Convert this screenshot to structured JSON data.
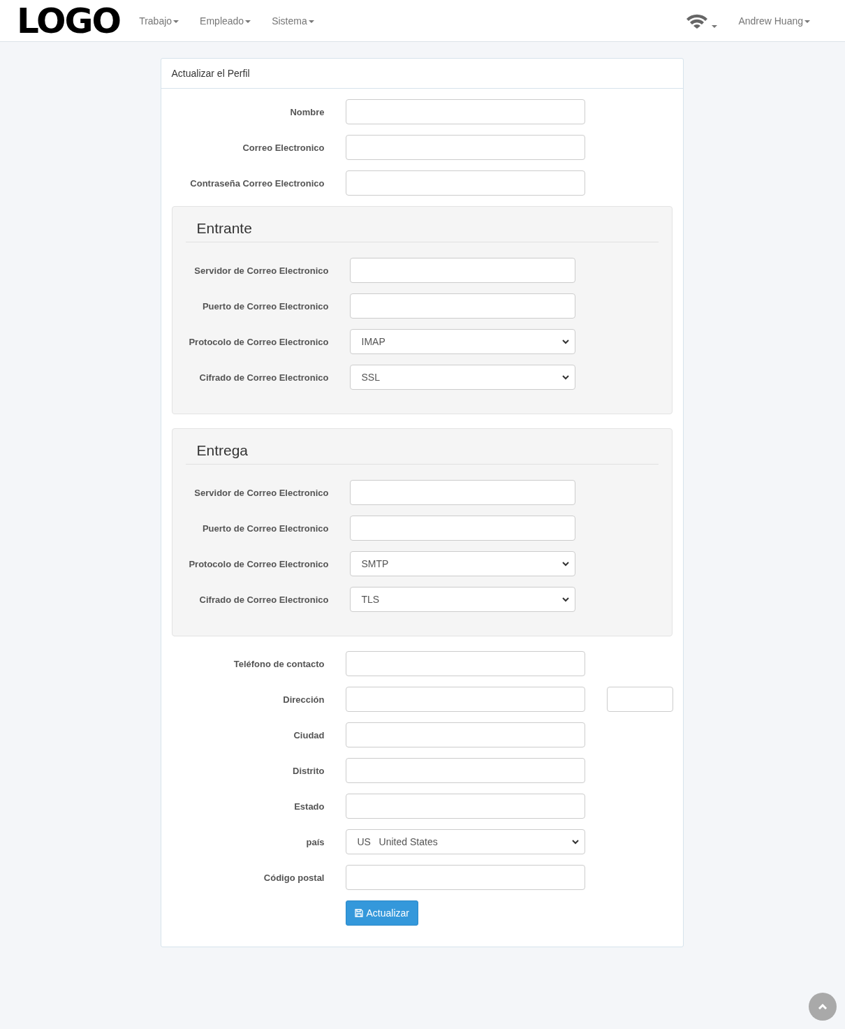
{
  "navbar": {
    "logo": "LOGO",
    "menus": [
      {
        "label": "Trabajo"
      },
      {
        "label": "Empleado"
      },
      {
        "label": "Sistema"
      }
    ],
    "user": "Andrew Huang"
  },
  "panel": {
    "title": "Actualizar el Perfil",
    "fields": [
      {
        "label": "Nombre",
        "kind": "text"
      },
      {
        "label": "Correo Electronico",
        "kind": "text"
      },
      {
        "label": "Contraseña Correo Electronico",
        "kind": "text"
      }
    ],
    "sections": [
      {
        "title": "Entrante",
        "fields": [
          {
            "label": "Servidor de Correo Electronico",
            "kind": "text"
          },
          {
            "label": "Puerto de Correo Electronico",
            "kind": "text"
          },
          {
            "label": "Protocolo de Correo Electronico",
            "kind": "select",
            "value": "IMAP"
          },
          {
            "label": "Cifrado de Correo Electronico",
            "kind": "select",
            "value": "SSL"
          }
        ]
      },
      {
        "title": "Entrega",
        "fields": [
          {
            "label": "Servidor de Correo Electronico",
            "kind": "text"
          },
          {
            "label": "Puerto de Correo Electronico",
            "kind": "text"
          },
          {
            "label": "Protocolo de Correo Electronico",
            "kind": "select",
            "value": "SMTP"
          },
          {
            "label": "Cifrado de Correo Electronico",
            "kind": "select",
            "value": "TLS"
          }
        ]
      }
    ],
    "fields_after": [
      {
        "label": "Teléfono de contacto",
        "kind": "text"
      },
      {
        "label": "Dirección",
        "kind": "split"
      },
      {
        "label": "Ciudad",
        "kind": "text"
      },
      {
        "label": "Distrito",
        "kind": "text"
      },
      {
        "label": "Estado",
        "kind": "text"
      },
      {
        "label": "país",
        "kind": "select",
        "value": "US   United States"
      },
      {
        "label": "Código postal",
        "kind": "text"
      }
    ],
    "submit": "Actualizar"
  }
}
